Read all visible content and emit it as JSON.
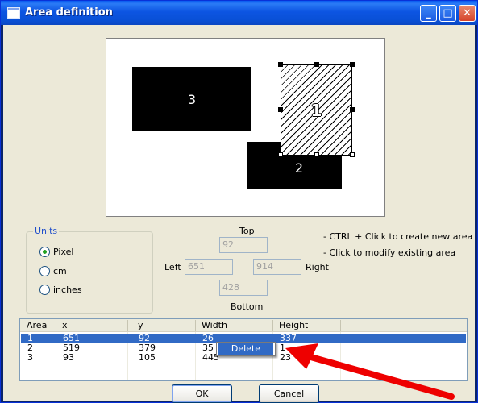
{
  "window": {
    "title": "Area definition",
    "buttons": [
      "minimize",
      "maximize",
      "close"
    ]
  },
  "preview": {
    "areas": [
      {
        "label": "3"
      },
      {
        "label": "2"
      },
      {
        "label": "1",
        "selected": true
      }
    ]
  },
  "units": {
    "legend": "Units",
    "options": [
      {
        "label": "Pixel",
        "checked": true
      },
      {
        "label": "cm",
        "checked": false
      },
      {
        "label": "inches",
        "checked": false
      }
    ]
  },
  "coords": {
    "top_label": "Top",
    "left_label": "Left",
    "right_label": "Right",
    "bottom_label": "Bottom",
    "top_value": "92",
    "left_value": "651",
    "right_value": "914",
    "bottom_value": "428"
  },
  "hints": [
    "- CTRL + Click to create new area",
    "- Click to modify existing area"
  ],
  "table": {
    "headers": [
      "Area",
      "x",
      "y",
      "Width",
      "Height"
    ],
    "rows": [
      [
        "1",
        "651",
        "92",
        "26",
        "337"
      ],
      [
        "2",
        "519",
        "379",
        "35",
        "1"
      ],
      [
        "3",
        "93",
        "105",
        "445",
        "23"
      ]
    ]
  },
  "context_menu": {
    "item": "Delete"
  },
  "buttons": {
    "ok": "OK",
    "cancel": "Cancel"
  },
  "colors": {
    "titlebar": "#0a5bf0",
    "selection": "#316ac5",
    "arrow": "#ee0000",
    "face": "#ece9d8"
  }
}
